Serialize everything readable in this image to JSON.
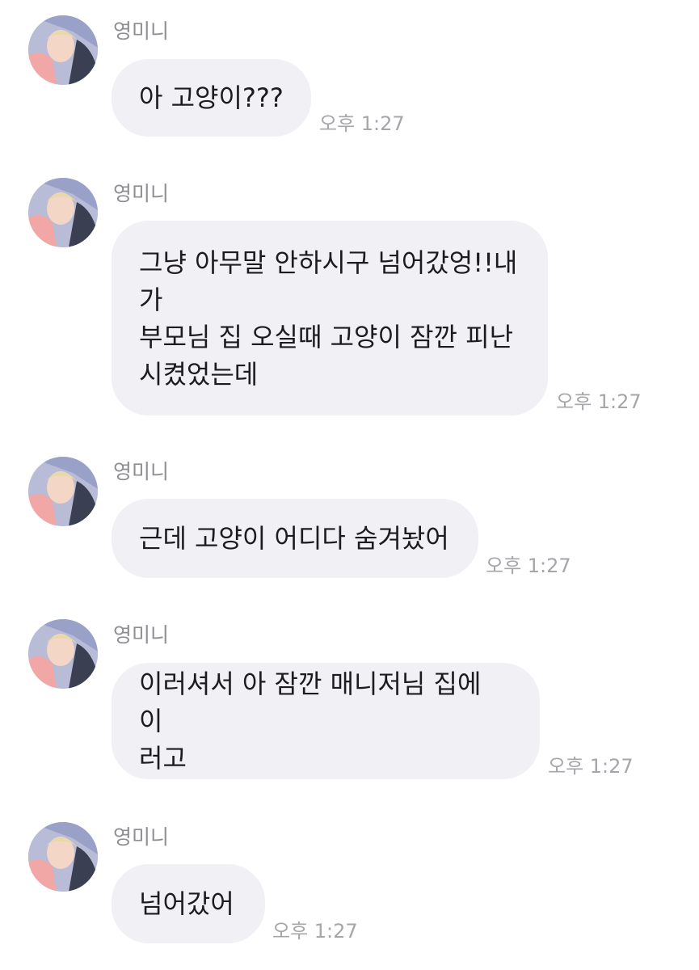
{
  "messages": [
    {
      "sender": "영미니",
      "text": "아 고양이???",
      "time": "오후 1:27"
    },
    {
      "sender": "영미니",
      "text": "그냥 아무말 안하시구 넘어갔엉!!내\n가\n부모님 집 오실때 고양이 잠깐 피난\n시켰었는데",
      "time": "오후 1:27"
    },
    {
      "sender": "영미니",
      "text": "근데 고양이 어디다 숨겨놨어",
      "time": "오후 1:27"
    },
    {
      "sender": "영미니",
      "text": "이러셔서 아 잠깐 매니저님 집에 이\n러고",
      "time": "오후 1:27"
    },
    {
      "sender": "영미니",
      "text": "넘어갔어",
      "time": "오후 1:27"
    }
  ]
}
